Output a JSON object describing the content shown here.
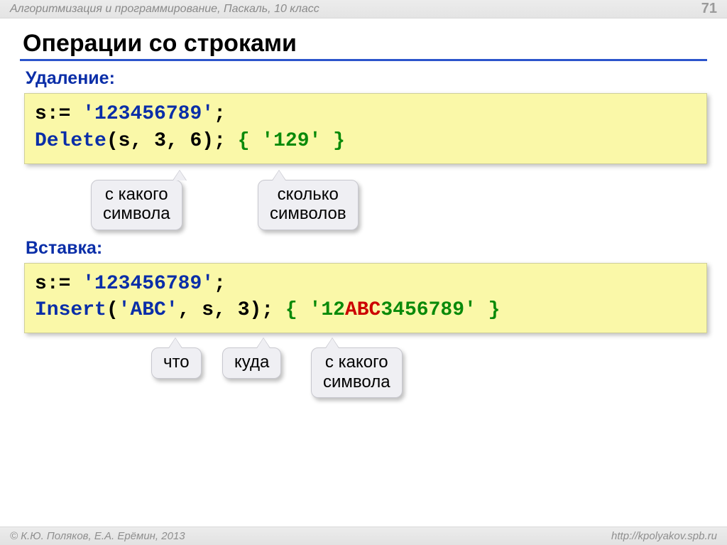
{
  "header": {
    "breadcrumb": "Алгоритмизация и программирование, Паскаль, 10 класс",
    "page_number": "71"
  },
  "title": "Операции со строками",
  "section1": {
    "heading": "Удаление:",
    "code": {
      "l1_var": "s",
      "l1_assign": ":= ",
      "l1_literal": "'123456789'",
      "l1_end": ";",
      "l2_proc": "Delete",
      "l2_open": "(",
      "l2_arg1": "s",
      "l2_sep1": ", ",
      "l2_arg2": "3",
      "l2_sep2": ", ",
      "l2_arg3": "6",
      "l2_close": "); ",
      "l2_comment": "{ '129' }"
    },
    "callouts": {
      "a": "с какого\nсимвола",
      "b": "сколько\nсимволов"
    }
  },
  "section2": {
    "heading": "Вставка:",
    "code": {
      "l1_var": "s",
      "l1_assign": ":= ",
      "l1_literal": "'123456789'",
      "l1_end": ";",
      "l2_proc": "Insert",
      "l2_open": "(",
      "l2_arg1": "'ABC'",
      "l2_sep1": ", ",
      "l2_arg2": "s",
      "l2_sep2": ", ",
      "l2_arg3": "3",
      "l2_close": "); ",
      "l2_comment_open": "{ '",
      "l2_comment_pre": "12",
      "l2_comment_mid": "ABC",
      "l2_comment_post": "3456789",
      "l2_comment_close": "' }"
    },
    "callouts": {
      "a": "что",
      "b": "куда",
      "c": "с какого\nсимвола"
    }
  },
  "footer": {
    "left": "© К.Ю. Поляков, Е.А. Ерёмин, 2013",
    "right": "http://kpolyakov.spb.ru"
  }
}
